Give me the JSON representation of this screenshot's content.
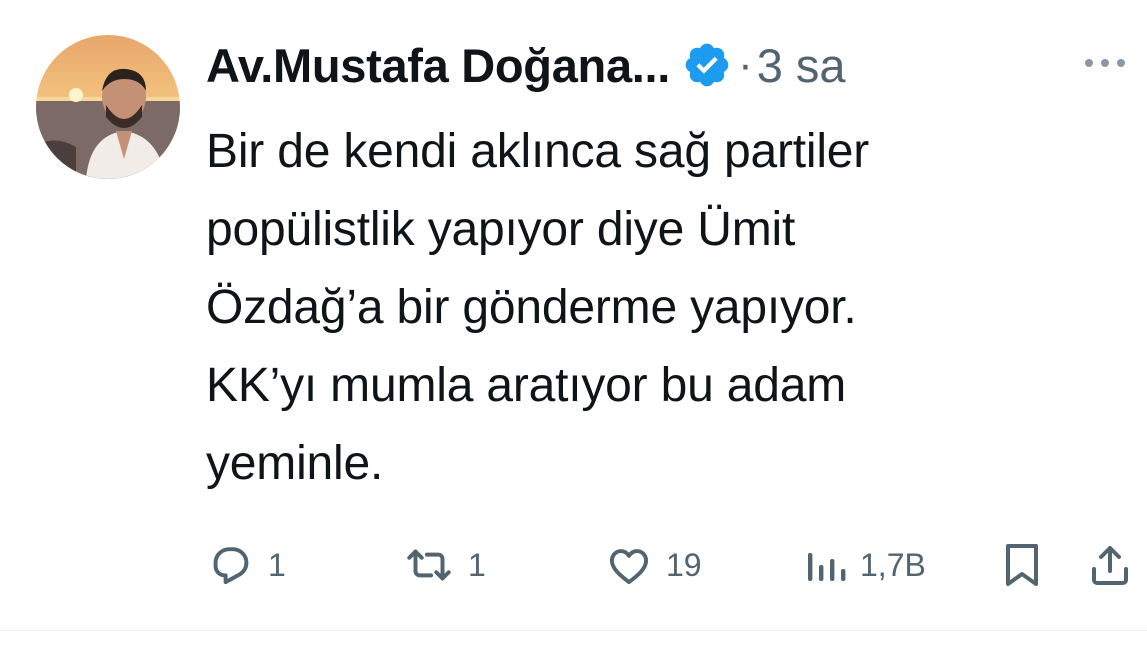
{
  "tweet": {
    "author": {
      "display_name": "Av.Mustafa Doğana...",
      "verified_icon": "verified-badge-icon",
      "verified_color": "#1d9bf0"
    },
    "separator": "·",
    "time": "3 sa",
    "text": "Bir de kendi aklınca sağ partiler\npopülistlik yapıyor diye Ümit\nÖzdağ’a bir gönderme yapıyor.\nKK’yı mumla aratıyor bu adam\nyeminle.",
    "actions": {
      "reply": {
        "icon": "reply-icon",
        "count": "1"
      },
      "retweet": {
        "icon": "retweet-icon",
        "count": "1"
      },
      "like": {
        "icon": "heart-icon",
        "count": "19"
      },
      "views": {
        "icon": "views-icon",
        "count": "1,7B"
      },
      "bookmark": {
        "icon": "bookmark-icon"
      },
      "share": {
        "icon": "share-icon"
      }
    },
    "colors": {
      "text_primary": "#0f1419",
      "text_secondary": "#536471",
      "verified": "#1d9bf0"
    }
  }
}
